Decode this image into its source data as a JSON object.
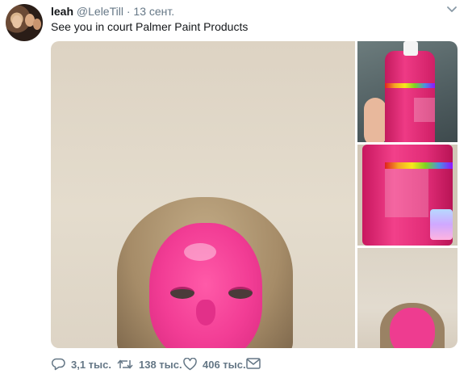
{
  "tweet": {
    "author_name": "leah",
    "author_handle": "@LeleTill",
    "separator": "·",
    "date": "13 сент.",
    "text": "See you in court Palmer Paint Products"
  },
  "actions": {
    "reply_count": "3,1 тыс.",
    "retweet_count": "138 тыс.",
    "like_count": "406 тыс."
  },
  "icons": {
    "more": "chevron-down-icon",
    "reply": "reply-icon",
    "retweet": "retweet-icon",
    "like": "heart-icon",
    "message": "envelope-icon"
  },
  "colors": {
    "text": "#14171a",
    "muted": "#657786",
    "pink": "#f23d95"
  }
}
